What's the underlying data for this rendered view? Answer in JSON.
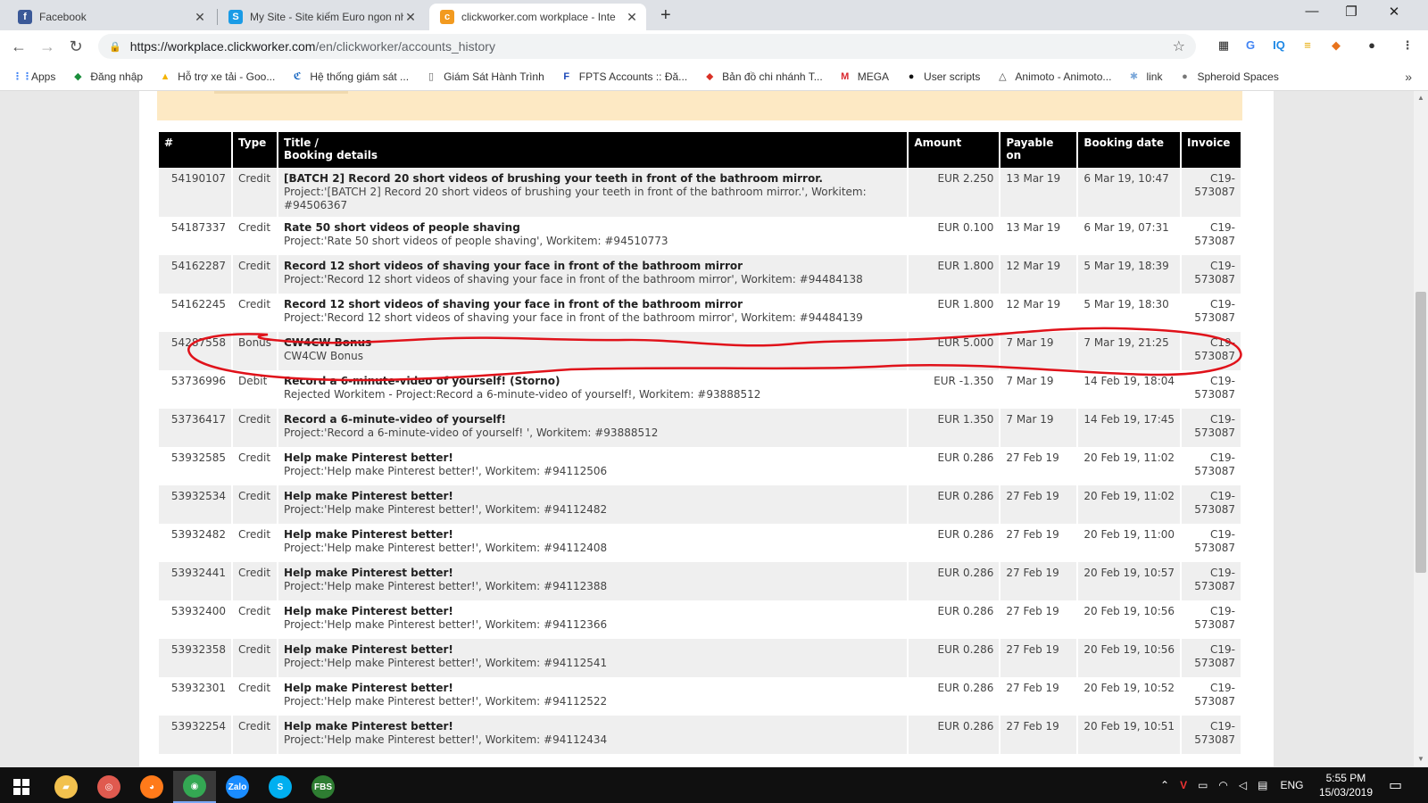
{
  "browser": {
    "tabs": [
      {
        "title": "Facebook",
        "icon": "facebook-icon",
        "color": "#3b5998",
        "glyph": "f"
      },
      {
        "title": "My Site - Site kiếm Euro ngon nh",
        "icon": "site-icon",
        "color": "#1a9be6",
        "glyph": "S"
      },
      {
        "title": "clickworker.com workplace - Inte",
        "icon": "clickworker-icon",
        "color": "#f29a1f",
        "glyph": "c"
      }
    ],
    "new_tab_symbol": "+",
    "window_controls": {
      "minimize": "—",
      "maximize": "❐",
      "close": "✕"
    },
    "url_host": "https://workplace.clickworker.com",
    "url_path": "/en/clickworker/accounts_history",
    "extensions": [
      {
        "name": "extension-icon",
        "glyph": "▦",
        "color": "#222"
      },
      {
        "name": "translate-icon",
        "glyph": "G",
        "color": "#4285f4"
      },
      {
        "name": "iq-icon",
        "glyph": "IQ",
        "color": "#1e88e5"
      },
      {
        "name": "stripes-icon",
        "glyph": "≡",
        "color": "#e6a800"
      },
      {
        "name": "fox-icon",
        "glyph": "◆",
        "color": "#e8731c"
      },
      {
        "name": "profile-avatar-icon",
        "glyph": "●",
        "color": "#333"
      },
      {
        "name": "menu-icon",
        "glyph": "⋮",
        "color": "#555"
      }
    ]
  },
  "bookmarks": [
    {
      "label": "Apps",
      "icon": "apps-icon",
      "glyph": "⋮⋮",
      "color": "#4285f4"
    },
    {
      "label": "Đăng nhập",
      "icon": "shield-icon",
      "glyph": "◆",
      "color": "#1b8e3c"
    },
    {
      "label": "Hỗ trợ xe tải - Goo...",
      "icon": "drive-icon",
      "glyph": "▲",
      "color": "#f4b400"
    },
    {
      "label": "Hệ thống giám sát ...",
      "icon": "tracking-icon",
      "glyph": "ℭ",
      "color": "#1565c0"
    },
    {
      "label": "Giám Sát Hành Trình",
      "icon": "page-icon",
      "glyph": "▯",
      "color": "#666"
    },
    {
      "label": "FPTS Accounts :: Đă...",
      "icon": "fpts-icon",
      "glyph": "F",
      "color": "#1a47b8"
    },
    {
      "label": "Bản đồ chi nhánh T...",
      "icon": "map-pin-icon",
      "glyph": "⬥",
      "color": "#d93025"
    },
    {
      "label": "MEGA",
      "icon": "mega-icon",
      "glyph": "M",
      "color": "#d9272e"
    },
    {
      "label": "User scripts",
      "icon": "userscripts-icon",
      "glyph": "●",
      "color": "#111"
    },
    {
      "label": "Animoto - Animoto...",
      "icon": "animoto-icon",
      "glyph": "△",
      "color": "#444"
    },
    {
      "label": "link",
      "icon": "link-icon",
      "glyph": "✱",
      "color": "#7aa7d9"
    },
    {
      "label": "Spheroid Spaces",
      "icon": "spheroid-icon",
      "glyph": "●",
      "color": "#777"
    }
  ],
  "bookmarks_more": "»",
  "table": {
    "headers": {
      "num": "#",
      "type": "Type",
      "title_line1": "Title /",
      "title_line2": "Booking details",
      "amount": "Amount",
      "payable": "Payable on",
      "booking": "Booking date",
      "invoice": "Invoice"
    },
    "rows": [
      {
        "num": "54190107",
        "type": "Credit",
        "title": "[BATCH 2] Record 20 short videos of brushing your teeth in front of the bathroom mirror.",
        "detail": "Project:'[BATCH 2] Record 20 short videos of brushing your teeth in front of the bathroom mirror.', Workitem: #94506367",
        "amount": "EUR 2.250",
        "payable": "13 Mar 19",
        "booking": "6 Mar 19, 10:47",
        "invoice": "C19-573087"
      },
      {
        "num": "54187337",
        "type": "Credit",
        "title": "Rate 50 short videos of people shaving",
        "detail": "Project:'Rate 50 short videos of people shaving', Workitem: #94510773",
        "amount": "EUR 0.100",
        "payable": "13 Mar 19",
        "booking": "6 Mar 19, 07:31",
        "invoice": "C19-573087"
      },
      {
        "num": "54162287",
        "type": "Credit",
        "title": "Record 12 short videos of shaving your face in front of the bathroom mirror",
        "detail": "Project:'Record 12 short videos of shaving your face in front of the bathroom mirror', Workitem: #94484138",
        "amount": "EUR 1.800",
        "payable": "12 Mar 19",
        "booking": "5 Mar 19, 18:39",
        "invoice": "C19-573087"
      },
      {
        "num": "54162245",
        "type": "Credit",
        "title": "Record 12 short videos of shaving your face in front of the bathroom mirror",
        "detail": "Project:'Record 12 short videos of shaving your face in front of the bathroom mirror', Workitem: #94484139",
        "amount": "EUR 1.800",
        "payable": "12 Mar 19",
        "booking": "5 Mar 19, 18:30",
        "invoice": "C19-573087"
      },
      {
        "num": "54287558",
        "type": "Bonus",
        "title": "CW4CW Bonus",
        "detail": "CW4CW Bonus",
        "amount": "EUR 5.000",
        "payable": "7 Mar 19",
        "booking": "7 Mar 19, 21:25",
        "invoice": "C19-573087"
      },
      {
        "num": "53736996",
        "type": "Debit",
        "title": "Record a 6-minute-video of yourself! (Storno)",
        "detail": "Rejected Workitem - Project:Record a 6-minute-video of yourself!, Workitem: #93888512",
        "amount": "EUR -1.350",
        "payable": "7 Mar 19",
        "booking": "14 Feb 19, 18:04",
        "invoice": "C19-573087"
      },
      {
        "num": "53736417",
        "type": "Credit",
        "title": "Record a 6-minute-video of yourself!",
        "detail": "Project:'Record a 6-minute-video of yourself! ', Workitem: #93888512",
        "amount": "EUR 1.350",
        "payable": "7 Mar 19",
        "booking": "14 Feb 19, 17:45",
        "invoice": "C19-573087"
      },
      {
        "num": "53932585",
        "type": "Credit",
        "title": "Help make Pinterest better!",
        "detail": "Project:'Help make Pinterest better!', Workitem: #94112506",
        "amount": "EUR 0.286",
        "payable": "27 Feb 19",
        "booking": "20 Feb 19, 11:02",
        "invoice": "C19-573087"
      },
      {
        "num": "53932534",
        "type": "Credit",
        "title": "Help make Pinterest better!",
        "detail": "Project:'Help make Pinterest better!', Workitem: #94112482",
        "amount": "EUR 0.286",
        "payable": "27 Feb 19",
        "booking": "20 Feb 19, 11:02",
        "invoice": "C19-573087"
      },
      {
        "num": "53932482",
        "type": "Credit",
        "title": "Help make Pinterest better!",
        "detail": "Project:'Help make Pinterest better!', Workitem: #94112408",
        "amount": "EUR 0.286",
        "payable": "27 Feb 19",
        "booking": "20 Feb 19, 11:00",
        "invoice": "C19-573087"
      },
      {
        "num": "53932441",
        "type": "Credit",
        "title": "Help make Pinterest better!",
        "detail": "Project:'Help make Pinterest better!', Workitem: #94112388",
        "amount": "EUR 0.286",
        "payable": "27 Feb 19",
        "booking": "20 Feb 19, 10:57",
        "invoice": "C19-573087"
      },
      {
        "num": "53932400",
        "type": "Credit",
        "title": "Help make Pinterest better!",
        "detail": "Project:'Help make Pinterest better!', Workitem: #94112366",
        "amount": "EUR 0.286",
        "payable": "27 Feb 19",
        "booking": "20 Feb 19, 10:56",
        "invoice": "C19-573087"
      },
      {
        "num": "53932358",
        "type": "Credit",
        "title": "Help make Pinterest better!",
        "detail": "Project:'Help make Pinterest better!', Workitem: #94112541",
        "amount": "EUR 0.286",
        "payable": "27 Feb 19",
        "booking": "20 Feb 19, 10:56",
        "invoice": "C19-573087"
      },
      {
        "num": "53932301",
        "type": "Credit",
        "title": "Help make Pinterest better!",
        "detail": "Project:'Help make Pinterest better!', Workitem: #94112522",
        "amount": "EUR 0.286",
        "payable": "27 Feb 19",
        "booking": "20 Feb 19, 10:52",
        "invoice": "C19-573087"
      },
      {
        "num": "53932254",
        "type": "Credit",
        "title": "Help make Pinterest better!",
        "detail": "Project:'Help make Pinterest better!', Workitem: #94112434",
        "amount": "EUR 0.286",
        "payable": "27 Feb 19",
        "booking": "20 Feb 19, 10:51",
        "invoice": "C19-573087"
      }
    ]
  },
  "annotation": {
    "color": "#e0121a"
  },
  "taskbar": {
    "apps": [
      {
        "name": "file-explorer-icon",
        "glyph": "▰",
        "color": "#f2c14e"
      },
      {
        "name": "app-circle-icon",
        "glyph": "◎",
        "color": "#e05a4f"
      },
      {
        "name": "firefox-icon",
        "glyph": "◕",
        "color": "#ff7a1a"
      },
      {
        "name": "chrome-icon",
        "glyph": "◉",
        "color": "#34a853"
      },
      {
        "name": "zalo-icon",
        "glyph": "Zalo",
        "color": "#1a8cff"
      },
      {
        "name": "skype-icon",
        "glyph": "S",
        "color": "#00aff0"
      },
      {
        "name": "fbs-icon",
        "glyph": "FBS",
        "color": "#2e7d32"
      }
    ],
    "language": "ENG",
    "time": "5:55 PM",
    "date": "15/03/2019"
  }
}
